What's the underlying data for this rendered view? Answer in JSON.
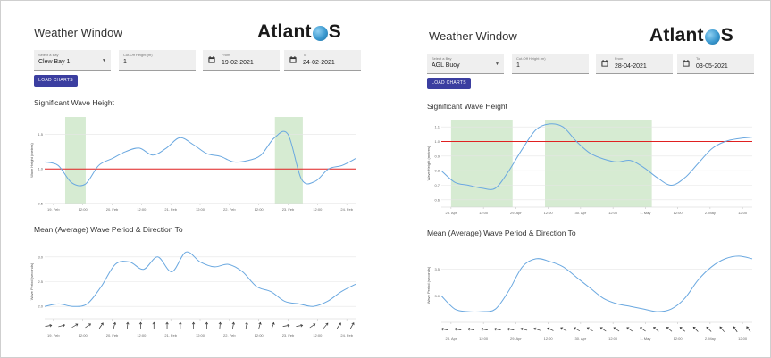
{
  "panels": [
    {
      "title": "Weather Window",
      "logo": {
        "text_left": "Atlant",
        "text_right": "S"
      },
      "bay": {
        "label": "Select a Bay",
        "value": "Clew Bay 1"
      },
      "cutoff": {
        "label": "Cut-Off Height (m)",
        "value": "1"
      },
      "from": {
        "label": "From",
        "value": "19-02-2021"
      },
      "to": {
        "label": "To",
        "value": "24-02-2021"
      },
      "load_button": "LOAD CHARTS",
      "wave_title": "Significant Wave Height",
      "period_title": "Mean (Average) Wave Period & Direction To",
      "wave_ylabel": "Wave Height (metres)",
      "period_ylabel": "Wave Period (seconds)",
      "wave_yticks": [
        "1.5",
        "1.0",
        "0.5"
      ],
      "period_yticks": [
        "3.0",
        "2.5",
        "2.0"
      ],
      "x_ticks": [
        "19. Feb",
        "12:00",
        "20. Feb",
        "12:00",
        "21. Feb",
        "12:00",
        "22. Feb",
        "12:00",
        "23. Feb",
        "12:00",
        "24. Feb"
      ],
      "period_x_ticks": [
        "19. Feb",
        "12:00",
        "20. Feb",
        "12:00",
        "21. Feb",
        "12:00",
        "22. Feb",
        "12:00",
        "23. Feb",
        "12:00",
        "24. Feb"
      ],
      "colors": {
        "line": "#6aa8e0",
        "threshold": "#e02020",
        "window": "#d6ebd2",
        "button": "#3b3ea0"
      }
    },
    {
      "title": "Weather Window",
      "logo": {
        "text_left": "Atlant",
        "text_right": "S"
      },
      "bay": {
        "label": "Select a Bay",
        "value": "AGL Buoy"
      },
      "cutoff": {
        "label": "Cut-Off Height (m)",
        "value": "1"
      },
      "from": {
        "label": "From",
        "value": "28-04-2021"
      },
      "to": {
        "label": "To",
        "value": "03-05-2021"
      },
      "load_button": "LOAD CHARTS",
      "wave_title": "Significant Wave Height",
      "period_title": "Mean (Average) Wave Period & Direction To",
      "wave_ylabel": "Wave Height (metres)",
      "period_ylabel": "Wave Period (seconds)",
      "wave_yticks": [
        "1.1",
        "1.0",
        "0.9",
        "0.8",
        "0.7",
        "0.6"
      ],
      "period_yticks": [
        "3.5",
        "3.0"
      ],
      "x_ticks": [
        "28. Apr",
        "12:00",
        "29. Apr",
        "12:00",
        "30. Apr",
        "12:00",
        "1. May",
        "12:00",
        "2. May",
        "12:00"
      ],
      "period_x_ticks": [
        "28. Apr",
        "12:00",
        "29. Apr",
        "12:00",
        "30. Apr",
        "12:00",
        "1. May",
        "12:00",
        "2. May",
        "12:00"
      ],
      "colors": {
        "line": "#6aa8e0",
        "threshold": "#e02020",
        "window": "#d6ebd2",
        "button": "#3b3ea0"
      }
    }
  ],
  "chart_data": [
    {
      "type": "line",
      "title": "Significant Wave Height",
      "ylabel": "Wave Height (metres)",
      "ylim": [
        0.5,
        1.75
      ],
      "x": [
        "19. Feb",
        "12:00",
        "20. Feb",
        "12:00",
        "21. Feb",
        "12:00",
        "22. Feb",
        "12:00",
        "23. Feb",
        "12:00",
        "24. Feb"
      ],
      "threshold": 1.0,
      "windows": [
        [
          0.4,
          1.1
        ],
        [
          7.55,
          8.5
        ]
      ],
      "series": [
        {
          "values": [
            1.1,
            1.05,
            0.8,
            0.78,
            1.05,
            1.15,
            1.25,
            1.3,
            1.2,
            1.3,
            1.45,
            1.35,
            1.22,
            1.18,
            1.1,
            1.12,
            1.2,
            1.45,
            1.5,
            0.85,
            0.82,
            1.0,
            1.05,
            1.15
          ]
        }
      ]
    },
    {
      "type": "line",
      "title": "Mean (Average) Wave Period & Direction To",
      "ylabel": "Wave Period (seconds)",
      "ylim": [
        1.75,
        3.25
      ],
      "x": [
        "19. Feb",
        "12:00",
        "20. Feb",
        "12:00",
        "21. Feb",
        "12:00",
        "22. Feb",
        "12:00",
        "23. Feb",
        "12:00",
        "24. Feb"
      ],
      "series": [
        {
          "values": [
            2.0,
            2.05,
            2.0,
            2.05,
            2.4,
            2.85,
            2.9,
            2.75,
            3.0,
            2.7,
            3.1,
            2.9,
            2.8,
            2.85,
            2.7,
            2.4,
            2.3,
            2.1,
            2.05,
            2.0,
            2.1,
            2.3,
            2.45
          ]
        }
      ],
      "arrow_angles": [
        80,
        75,
        60,
        55,
        35,
        15,
        5,
        0,
        0,
        0,
        0,
        0,
        0,
        5,
        10,
        10,
        15,
        20,
        80,
        80,
        55,
        40,
        35,
        30
      ]
    },
    {
      "type": "line",
      "title": "Significant Wave Height",
      "ylabel": "Wave Height (metres)",
      "ylim": [
        0.55,
        1.15
      ],
      "x": [
        "28. Apr",
        "12:00",
        "29. Apr",
        "12:00",
        "30. Apr",
        "12:00",
        "1. May",
        "12:00",
        "2. May",
        "12:00"
      ],
      "threshold": 1.0,
      "windows": [
        [
          0.0,
          1.9
        ],
        [
          2.9,
          6.2
        ]
      ],
      "series": [
        {
          "values": [
            0.8,
            0.72,
            0.7,
            0.68,
            0.68,
            0.8,
            0.95,
            1.08,
            1.12,
            1.1,
            1.0,
            0.92,
            0.88,
            0.86,
            0.87,
            0.82,
            0.75,
            0.7,
            0.75,
            0.85,
            0.95,
            1.0,
            1.02,
            1.03
          ]
        }
      ]
    },
    {
      "type": "line",
      "title": "Mean (Average) Wave Period & Direction To",
      "ylabel": "Wave Period (seconds)",
      "ylim": [
        2.5,
        3.9
      ],
      "x": [
        "28. Apr",
        "12:00",
        "29. Apr",
        "12:00",
        "30. Apr",
        "12:00",
        "1. May",
        "12:00",
        "2. May",
        "12:00"
      ],
      "series": [
        {
          "values": [
            3.0,
            2.75,
            2.7,
            2.7,
            2.75,
            3.1,
            3.55,
            3.7,
            3.65,
            3.55,
            3.35,
            3.15,
            2.95,
            2.85,
            2.8,
            2.75,
            2.7,
            2.75,
            2.95,
            3.3,
            3.55,
            3.7,
            3.75,
            3.7
          ]
        }
      ],
      "arrow_angles": [
        -80,
        -80,
        -80,
        -80,
        -80,
        -80,
        -75,
        -70,
        -65,
        -60,
        -60,
        -60,
        -55,
        -55,
        -55,
        -55,
        -50,
        -50,
        -50,
        -45,
        -45,
        -40,
        -35,
        -35
      ]
    }
  ]
}
